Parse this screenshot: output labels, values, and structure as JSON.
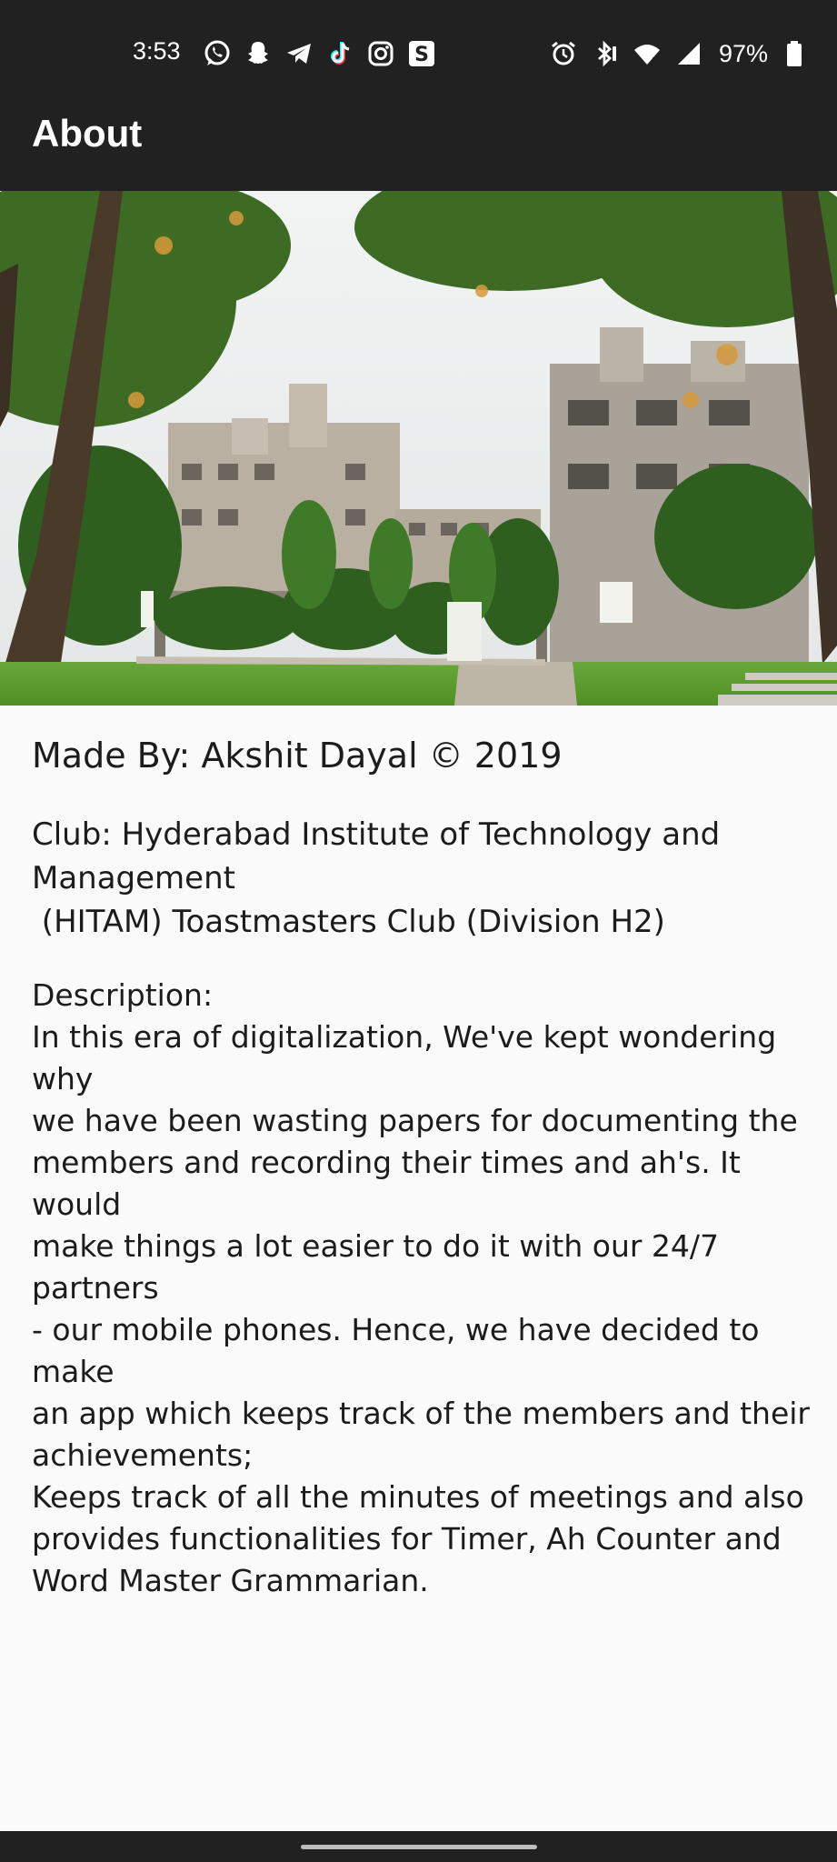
{
  "status_bar": {
    "time": "3:53",
    "battery_percent": "97%",
    "left_icons": [
      "whatsapp-icon",
      "snapchat-icon",
      "telegram-icon",
      "tiktok-icon",
      "instagram-icon",
      "s-app-icon"
    ],
    "right_icons": [
      "alarm-icon",
      "bluetooth-icon",
      "wifi-icon",
      "signal-icon",
      "battery-icon"
    ]
  },
  "app_bar": {
    "title": "About"
  },
  "hero_image": {
    "description_icon": "campus-photo"
  },
  "content": {
    "made_by": "Made By: Akshit Dayal © 2019",
    "club_line1": "Club: Hyderabad Institute of Technology and",
    "club_line2": "Management",
    "club_line3": " (HITAM) Toastmasters Club (Division H2)",
    "description_label": "Description:",
    "description_lines": [
      "In this era of digitalization, We've kept wondering why",
      "we have been wasting papers for documenting the",
      "members and recording their times and ah's. It would",
      "make things a lot easier to do it with our 24/7 partners",
      "- our mobile phones. Hence, we have decided to make",
      "an app which keeps track of the members and their",
      "achievements;",
      "Keeps track of all the minutes of meetings and also",
      "provides functionalities for Timer, Ah Counter and",
      "Word Master Grammarian."
    ]
  },
  "colors": {
    "bar_background": "#212121",
    "page_background": "#fafafa",
    "text": "#1c1c1c"
  }
}
